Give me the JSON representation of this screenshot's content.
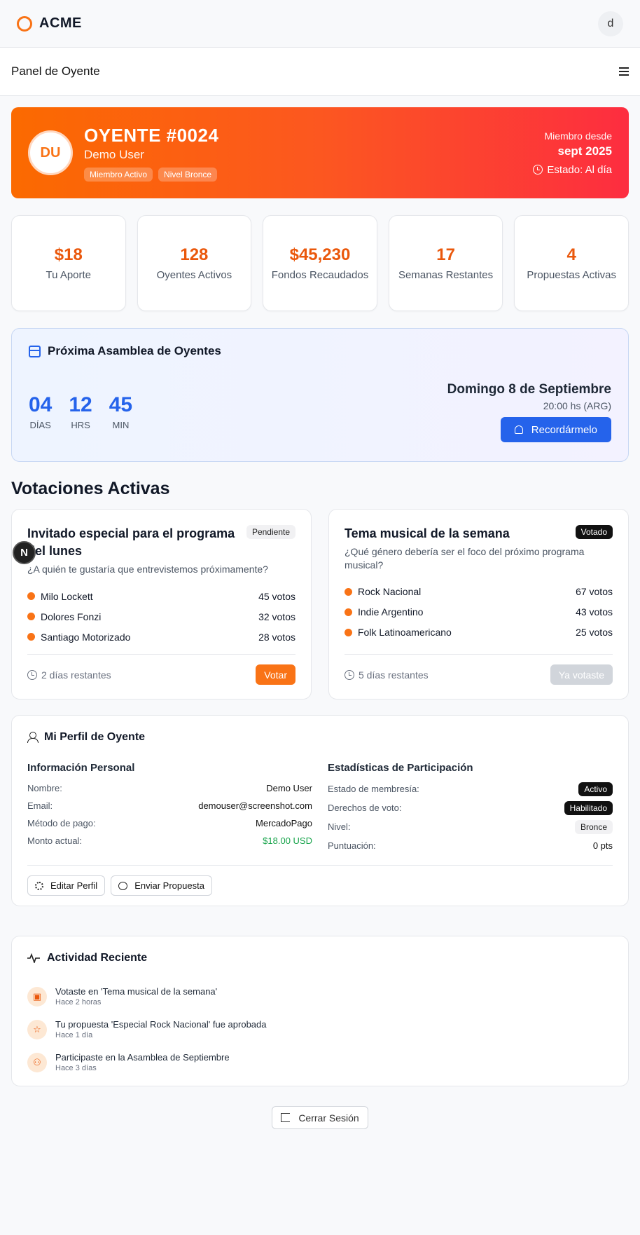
{
  "brand": {
    "name": "ACME",
    "avatar_letter": "d"
  },
  "subbar": {
    "title": "Panel de Oyente"
  },
  "hero": {
    "initials": "DU",
    "listener_id": "OYENTE #0024",
    "user_name": "Demo User",
    "badges": [
      "Miembro Activo",
      "Nivel Bronce"
    ],
    "member_since_label": "Miembro desde",
    "member_since": "sept 2025",
    "status": "Estado: Al día"
  },
  "stats": [
    {
      "value": "$18",
      "label": "Tu Aporte"
    },
    {
      "value": "128",
      "label": "Oyentes Activos"
    },
    {
      "value": "$45,230",
      "label": "Fondos Recaudados"
    },
    {
      "value": "17",
      "label": "Semanas Restantes"
    },
    {
      "value": "4",
      "label": "Propuestas Activas"
    }
  ],
  "assembly": {
    "title": "Próxima Asamblea de Oyentes",
    "countdown": [
      {
        "value": "04",
        "unit": "DÍAS"
      },
      {
        "value": "12",
        "unit": "HRS"
      },
      {
        "value": "45",
        "unit": "MIN"
      }
    ],
    "date": "Domingo 8 de Septiembre",
    "time": "20:00 hs (ARG)",
    "remind_label": "Recordármelo"
  },
  "votes_section": {
    "title": "Votaciones Activas"
  },
  "votes": [
    {
      "title": "Invitado especial para el programa del lunes",
      "status": "Pendiente",
      "description": "¿A quién te gustaría que entrevistemos próximamente?",
      "options": [
        {
          "label": "Milo Lockett",
          "votes": "45 votos"
        },
        {
          "label": "Dolores Fonzi",
          "votes": "32 votos"
        },
        {
          "label": "Santiago Motorizado",
          "votes": "28 votos"
        }
      ],
      "remaining": "2 días restantes",
      "action": "Votar"
    },
    {
      "title": "Tema musical de la semana",
      "status": "Votado",
      "description": "¿Qué género debería ser el foco del próximo programa musical?",
      "options": [
        {
          "label": "Rock Nacional",
          "votes": "67 votos"
        },
        {
          "label": "Indie Argentino",
          "votes": "43 votos"
        },
        {
          "label": "Folk Latinoamericano",
          "votes": "25 votos"
        }
      ],
      "remaining": "5 días restantes",
      "action": "Ya votaste"
    }
  ],
  "overlay_badge": "N",
  "profile": {
    "title": "Mi Perfil de Oyente",
    "personal_title": "Información Personal",
    "personal": [
      {
        "key": "Nombre:",
        "value": "Demo User"
      },
      {
        "key": "Email:",
        "value": "demouser@screenshot.com"
      },
      {
        "key": "Método de pago:",
        "value": "MercadoPago"
      },
      {
        "key": "Monto actual:",
        "value": "$18.00 USD"
      }
    ],
    "stats_title": "Estadísticas de Participación",
    "participation": [
      {
        "key": "Estado de membresía:",
        "value": "Activo"
      },
      {
        "key": "Derechos de voto:",
        "value": "Habilitado"
      },
      {
        "key": "Nivel:",
        "value": "Bronce"
      },
      {
        "key": "Puntuación:",
        "value": "0 pts"
      }
    ],
    "edit_label": "Editar Perfil",
    "proposal_label": "Enviar Propuesta"
  },
  "activity": {
    "title": "Actividad Reciente",
    "items": [
      {
        "text": "Votaste en 'Tema musical de la semana'",
        "time": "Hace 2 horas",
        "icon": "vote-icon"
      },
      {
        "text": "Tu propuesta 'Especial Rock Nacional' fue aprobada",
        "time": "Hace 1 día",
        "icon": "star-icon"
      },
      {
        "text": "Participaste en la Asamblea de Septiembre",
        "time": "Hace 3 días",
        "icon": "users-icon"
      }
    ]
  },
  "logout_label": "Cerrar Sesión",
  "colors": {
    "accent": "#f97316",
    "blue": "#2563eb",
    "green": "#16a34a"
  }
}
